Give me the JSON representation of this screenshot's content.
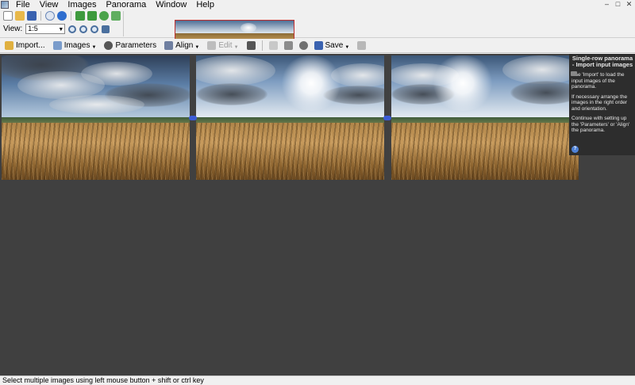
{
  "menu": {
    "items": [
      "File",
      "View",
      "Images",
      "Panorama",
      "Window",
      "Help"
    ]
  },
  "window_controls": {
    "minimize": "–",
    "maximize": "□",
    "close": "✕"
  },
  "view": {
    "label": "View:",
    "zoom_value": "1:5"
  },
  "toolbar2": {
    "import_label": "Import...",
    "images_label": "Images",
    "parameters_label": "Parameters",
    "align_label": "Align",
    "edit_label": "Edit",
    "save_label": "Save"
  },
  "help": {
    "title": "Single-row panorama - Import input images",
    "para1": "Use 'Import' to load the input images of the panorama.",
    "para2": "If necessary arrange the images in the right order and orientation.",
    "para3": "Continue with setting up the 'Parameters' or 'Align' the panorama."
  },
  "status": {
    "text": "Select multiple images using left mouse button + shift or ctrl key"
  },
  "colors": {
    "canvas_bg": "#404040",
    "help_bg": "#2d2d2d",
    "link_marker": "#3b5cd6",
    "thumb_border": "#c03030"
  }
}
